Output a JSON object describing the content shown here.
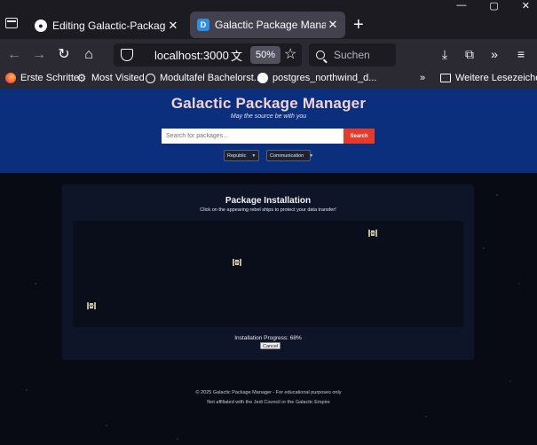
{
  "browser": {
    "tabs": [
      {
        "title": "Editing Galactic-Package-Manag",
        "favicon": "github-icon",
        "active": false
      },
      {
        "title": "Galactic Package Manager",
        "favicon": "d-icon",
        "active": true
      }
    ],
    "new_tab_symbol": "+",
    "url": "localhost:3000",
    "zoom": "50%",
    "search_placeholder": "Suchen",
    "bookmarks": [
      {
        "label": "Erste Schritte",
        "icon": "firefox-icon"
      },
      {
        "label": "Most Visited",
        "icon": "gear-icon"
      },
      {
        "label": "Modultafel Bachelorst...",
        "icon": "globe-icon"
      },
      {
        "label": "postgres_northwind_d...",
        "icon": "github-icon"
      }
    ],
    "bookmarks_overflow": "»",
    "other_bookmarks": "Weitere Lesezeichen"
  },
  "hero": {
    "title": "Galactic Package Manager",
    "tagline": "May the source be with you",
    "search_placeholder": "Search for packages...",
    "search_button": "Search",
    "filters": [
      {
        "selected": "Republic"
      },
      {
        "selected": "Communication"
      }
    ]
  },
  "install": {
    "title": "Package Installation",
    "hint": "Click on the appearing rebel ships to protect your data transfer!",
    "progress_label": "Installation Progress: 68%",
    "progress_value": 68,
    "cancel_button": "Cancel",
    "ships": [
      {
        "name": "rebel-ship-1",
        "icon": "rebel-ship-icon"
      },
      {
        "name": "rebel-ship-2",
        "icon": "rebel-ship-icon"
      },
      {
        "name": "rebel-ship-3",
        "icon": "rebel-ship-icon"
      }
    ]
  },
  "footer": {
    "line1": "© 2025 Galactic Package Manager - For educational purposes only",
    "line2": "Not affiliated with the Jedi Council or the Galactic Empire"
  }
}
